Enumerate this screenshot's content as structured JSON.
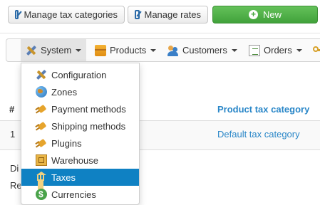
{
  "toolbar": {
    "manage_tax_categories": "Manage tax categories",
    "manage_rates": "Manage rates",
    "new": "New"
  },
  "menu": {
    "system": "System",
    "products": "Products",
    "customers": "Customers",
    "orders": "Orders"
  },
  "dropdown": {
    "items": [
      {
        "label": "Configuration",
        "icon": "tools-icon"
      },
      {
        "label": "Zones",
        "icon": "globe-icon"
      },
      {
        "label": "Payment methods",
        "icon": "plug-icon"
      },
      {
        "label": "Shipping methods",
        "icon": "plug-icon"
      },
      {
        "label": "Plugins",
        "icon": "plug-icon"
      },
      {
        "label": "Warehouse",
        "icon": "warehouse-icon"
      },
      {
        "label": "Taxes",
        "icon": "bank-icon",
        "selected": true
      },
      {
        "label": "Currencies",
        "icon": "coin-icon"
      }
    ]
  },
  "table": {
    "headers": [
      "#",
      "Product tax category"
    ],
    "rows": [
      {
        "num": "1",
        "category": "Default tax category"
      }
    ]
  },
  "fragments": [
    "Di",
    "Re"
  ],
  "colors": {
    "accent": "#0f81c3",
    "link": "#2a87c8",
    "new_button": "#47a840"
  }
}
